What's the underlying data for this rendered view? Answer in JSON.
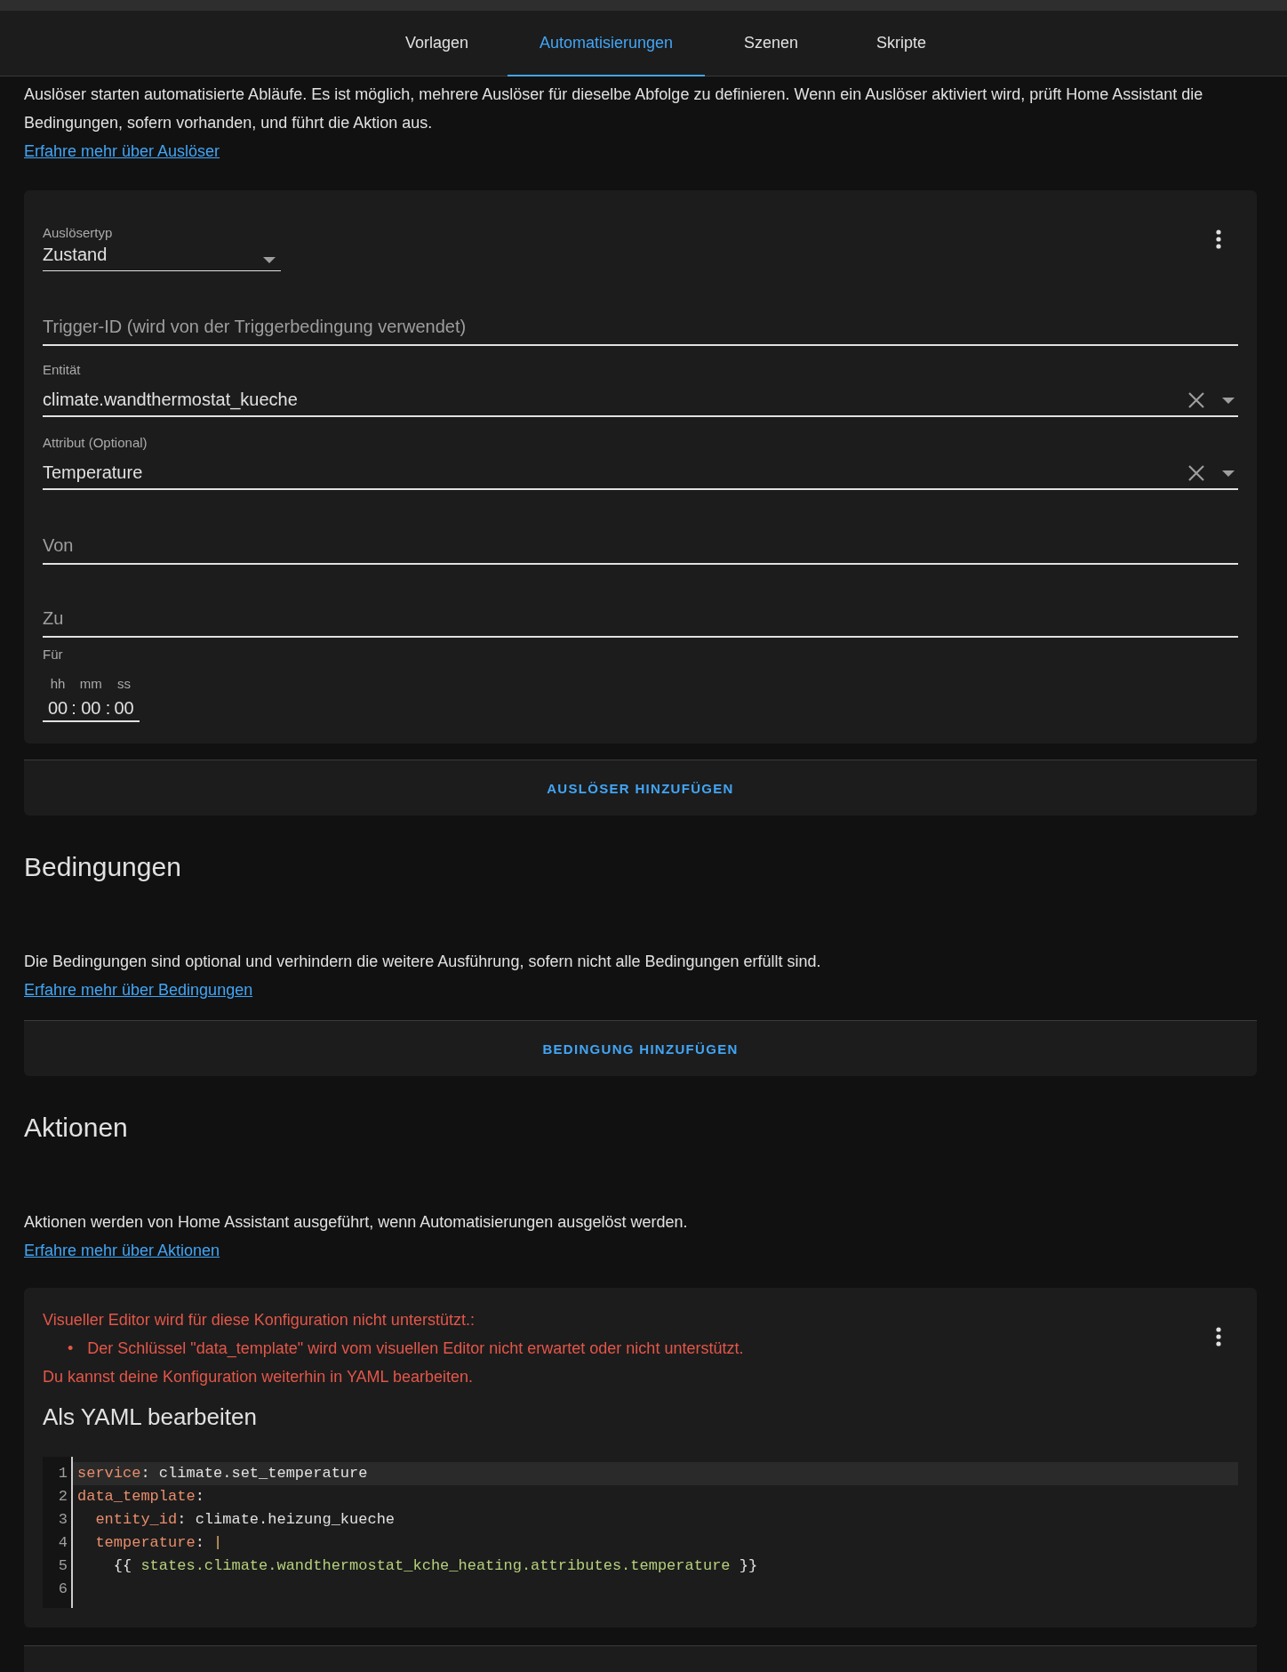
{
  "tabs": [
    {
      "label": "Vorlagen",
      "selected": false
    },
    {
      "label": "Automatisierungen",
      "selected": true
    },
    {
      "label": "Szenen",
      "selected": false
    },
    {
      "label": "Skripte",
      "selected": false
    }
  ],
  "triggers": {
    "description": "Auslöser starten automatisierte Abläufe. Es ist möglich, mehrere Auslöser für dieselbe Abfolge zu definieren. Wenn ein Auslöser aktiviert wird, prüft Home Assistant die Bedingungen, sofern vorhanden, und führt die Aktion aus.",
    "link": "Erfahre mehr über Auslöser",
    "fields": [
      {
        "kind": "select",
        "label": "Auslösertyp",
        "value": "Zustand"
      },
      {
        "kind": "text",
        "placeholder": "Trigger-ID (wird von der Triggerbedingung verwendet)"
      },
      {
        "kind": "combo",
        "label": "Entität",
        "value": "climate.wandthermostat_kueche"
      },
      {
        "kind": "combo",
        "label": "Attribut (Optional)",
        "value": "Temperature"
      },
      {
        "kind": "text",
        "placeholder": "Von"
      },
      {
        "kind": "text",
        "placeholder": "Zu"
      },
      {
        "kind": "duration",
        "label": "Für",
        "units": [
          "hh",
          "mm",
          "ss"
        ],
        "values": [
          "00",
          "00",
          "00"
        ],
        "separator": ":"
      }
    ],
    "add_button": "AUSLÖSER HINZUFÜGEN"
  },
  "conditions": {
    "heading": "Bedingungen",
    "description": "Die Bedingungen sind optional und verhindern die weitere Ausführung, sofern nicht alle Bedingungen erfüllt sind.",
    "link": "Erfahre mehr über Bedingungen",
    "add_button": "BEDINGUNG HINZUFÜGEN"
  },
  "actions": {
    "heading": "Aktionen",
    "description": "Aktionen werden von Home Assistant ausgeführt, wenn Automatisierungen ausgelöst werden.",
    "link": "Erfahre mehr über Aktionen",
    "error_title": "Visueller Editor wird für diese Konfiguration nicht unterstützt.:",
    "error_items": [
      {
        "bullet": "•",
        "text": "Der Schlüssel \"data_template\" wird vom visuellen Editor nicht erwartet oder nicht unterstützt."
      }
    ],
    "error_note": "Du kannst deine Konfiguration weiterhin in YAML bearbeiten.",
    "yaml_heading": "Als YAML bearbeiten",
    "code": [
      {
        "number": "1",
        "active": true,
        "tokens": [
          {
            "kind": "key",
            "text": "service"
          },
          {
            "kind": "punct",
            "text": ": "
          },
          {
            "kind": "plain",
            "text": "climate.set_temperature"
          }
        ]
      },
      {
        "number": "2",
        "active": false,
        "tokens": [
          {
            "kind": "key",
            "text": "data_template"
          },
          {
            "kind": "punct",
            "text": ":"
          }
        ]
      },
      {
        "number": "3",
        "active": false,
        "tokens": [
          {
            "kind": "key",
            "text": "  entity_id"
          },
          {
            "kind": "punct",
            "text": ": "
          },
          {
            "kind": "plain",
            "text": "climate.heizung_kueche"
          }
        ]
      },
      {
        "number": "4",
        "active": false,
        "tokens": [
          {
            "kind": "key",
            "text": "  temperature"
          },
          {
            "kind": "punct",
            "text": ": "
          },
          {
            "kind": "indicator",
            "text": "|"
          }
        ]
      },
      {
        "number": "5",
        "active": false,
        "tokens": [
          {
            "kind": "plain",
            "text": "    {{ "
          },
          {
            "kind": "string",
            "text": "states.climate.wandthermostat_kche_heating.attributes.temperature"
          },
          {
            "kind": "plain",
            "text": " }}"
          }
        ]
      },
      {
        "number": "6",
        "active": false
      }
    ]
  }
}
